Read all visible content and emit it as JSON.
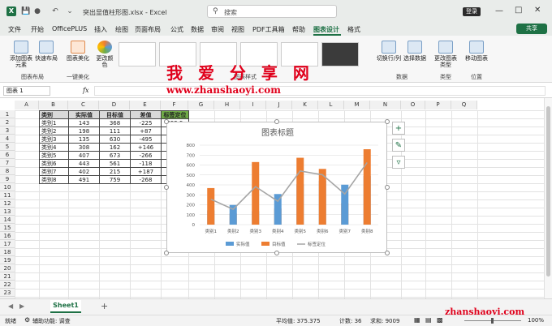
{
  "titlebar": {
    "app_name": "Excel",
    "file_name": "突出显值柱形图.xlsx - Excel",
    "search_placeholder": "搜索",
    "login_label": "登录"
  },
  "menu": [
    "文件",
    "开始",
    "OfficePLUS",
    "插入",
    "绘图",
    "页面布局",
    "公式",
    "数据",
    "审阅",
    "视图",
    "PDF工具箱",
    "帮助",
    "图表设计",
    "格式"
  ],
  "share_label": "共享",
  "ribbon": {
    "add_element": "添加图表元素",
    "quick_layout": "快速布局",
    "beautify": "图表美化",
    "change_colors": "更改颜色",
    "group_layout": "图表布局",
    "group_beautify": "一键美化",
    "group_styles": "图表样式",
    "switch_rowcol": "切换行/列",
    "select_data": "选择数据",
    "group_data": "数据",
    "change_type": "更改图表类型",
    "group_type": "类型",
    "move_chart": "移动图表",
    "group_location": "位置"
  },
  "formula": {
    "name_box": "图表 1",
    "fx": "fx"
  },
  "columns": [
    "A",
    "B",
    "C",
    "D",
    "E",
    "F",
    "G",
    "H",
    "I",
    "J",
    "K",
    "L",
    "M",
    "N",
    "O",
    "P",
    "Q"
  ],
  "rows": [
    "1",
    "2",
    "3",
    "4",
    "5",
    "6",
    "7",
    "8",
    "9",
    "10",
    "11",
    "12",
    "13",
    "14",
    "15",
    "16",
    "17",
    "18",
    "19",
    "20",
    "21",
    "22",
    "23",
    "24"
  ],
  "table": {
    "headers": [
      "类别",
      "实际值",
      "目标值",
      "差值",
      "标签定位"
    ],
    "rows": [
      [
        "类别1",
        "143",
        "368",
        "-225",
        "255.5"
      ],
      [
        "类别2",
        "198",
        "111",
        "+87",
        "154.5"
      ],
      [
        "类别3",
        "135",
        "630",
        "-495",
        "382.5"
      ],
      [
        "类别4",
        "308",
        "162",
        "+146",
        "235"
      ],
      [
        "类别5",
        "407",
        "673",
        "-266",
        "540"
      ],
      [
        "类别6",
        "443",
        "561",
        "-118",
        "502"
      ],
      [
        "类别7",
        "402",
        "215",
        "+187",
        "308.5"
      ],
      [
        "类别8",
        "491",
        "759",
        "-268",
        "625"
      ]
    ]
  },
  "chart_data": {
    "type": "bar",
    "title": "图表标题",
    "categories": [
      "类别1",
      "类别2",
      "类别3",
      "类别4",
      "类别5",
      "类别6",
      "类别7",
      "类别8"
    ],
    "series": [
      {
        "name": "实际值",
        "values": [
          143,
          198,
          135,
          308,
          407,
          443,
          402,
          491
        ],
        "color": "#5b9bd5"
      },
      {
        "name": "目标值",
        "values": [
          368,
          111,
          630,
          162,
          673,
          561,
          215,
          759
        ],
        "color": "#ed7d31"
      },
      {
        "name": "标签定位",
        "values": [
          255.5,
          154.5,
          382.5,
          235,
          540,
          502,
          308.5,
          625
        ],
        "color": "#a5a5a5",
        "type": "line"
      }
    ],
    "yticks": [
      "0",
      "100",
      "200",
      "300",
      "400",
      "500",
      "600",
      "700",
      "800"
    ],
    "ylim": [
      0,
      800
    ],
    "legend_position": "bottom"
  },
  "sheet_tab": "Sheet1",
  "status": {
    "ready": "就绪",
    "accessibility": "辅助功能: 调查",
    "average": "平均值: 375.375",
    "count": "计数: 36",
    "sum": "求和: 9009",
    "zoom": "100%"
  },
  "watermark": {
    "cn": "我 爱 分 享 网",
    "url": "www.zhanshaoyi.com",
    "url2": "zhanshaoyi.com"
  },
  "colors": {
    "accent": "#1e7145",
    "header_fill": "#d9d9d9",
    "highlight_fill": "#70ad47"
  }
}
